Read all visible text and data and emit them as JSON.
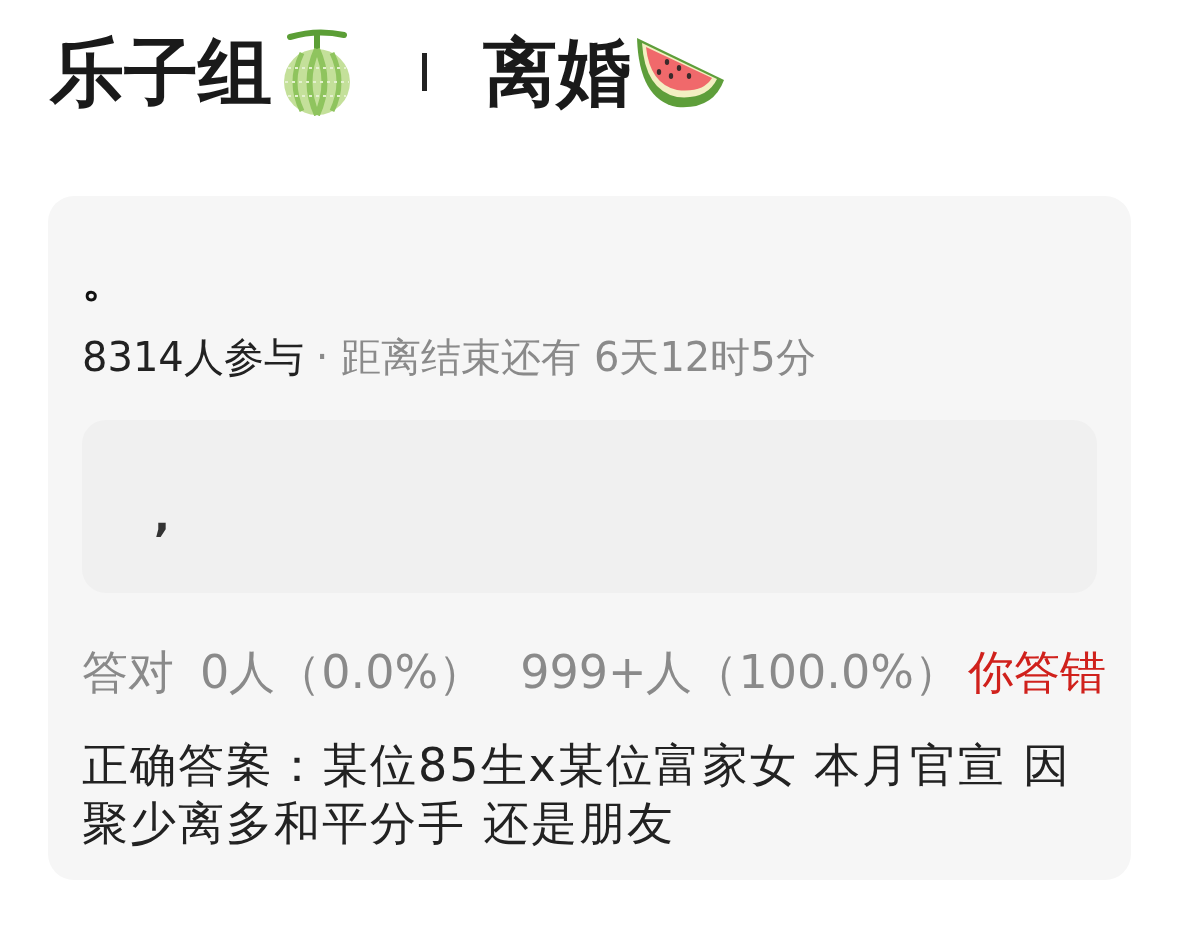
{
  "header": {
    "group": "乐子组",
    "topic": "离婚"
  },
  "card": {
    "title": "。",
    "participants": "8314人参与",
    "countdown": "· 距离结束还有 6天12时5分",
    "option": ",",
    "stats": {
      "label": "答对",
      "correct_count": "0人（0.0%）",
      "wrong_count": "999+人（100.0%）"
    },
    "result": {
      "text": "你答错",
      "correct": false
    },
    "answer": "正确答案：某位85生x某位富家女 本月官宣 因聚少离多和平分手 还是朋友"
  }
}
